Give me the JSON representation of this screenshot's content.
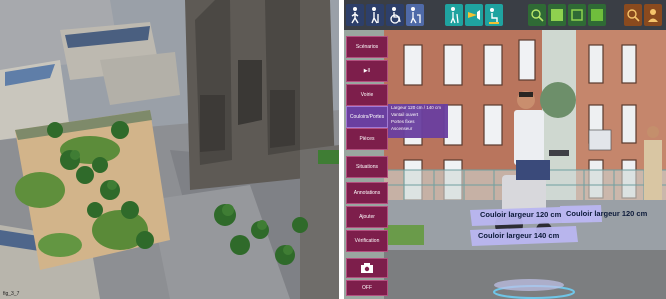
{
  "left_scene": {
    "watermark": "fig_3_7"
  },
  "toolbar": {
    "buttons": [
      {
        "icon": "pedestrian-icon"
      },
      {
        "icon": "elderly-person-icon"
      },
      {
        "icon": "wheelchair-icon"
      },
      {
        "icon": "walker-icon"
      },
      {
        "icon": "cane-person-icon"
      },
      {
        "icon": "camera-view-icon"
      },
      {
        "icon": "person-sitting-icon"
      },
      {
        "icon": "zoom-in-icon"
      },
      {
        "icon": "panel-icon"
      },
      {
        "icon": "square-icon"
      },
      {
        "icon": "screen-icon"
      },
      {
        "icon": "user-icon"
      },
      {
        "icon": "search-icon"
      }
    ]
  },
  "menu": {
    "items": [
      {
        "label": "Scénarios"
      },
      {
        "label": "▶II"
      },
      {
        "label": "Voirie"
      },
      {
        "label": "Couloirs/Portes"
      },
      {
        "label": "Pièces"
      },
      {
        "label": "Situations"
      },
      {
        "label": "Annotations"
      },
      {
        "label": "Ajouter"
      },
      {
        "label": "Vérification"
      }
    ],
    "photo_icon": "camera-icon",
    "off_label": "OFF"
  },
  "submenu": {
    "items": [
      "Largeur 120 cm / 140 cm",
      "Vantail ouvert",
      "Portes fixes",
      "Ascenseur"
    ]
  },
  "labels": {
    "corridor_120": "Couloir largeur 120 cm",
    "corridor_140": "Couloir largeur 140 cm"
  },
  "colors": {
    "menu_bg": "#7d1e4b",
    "menu_active": "#6a3fa0",
    "toolbar_bg": "#3a3e45",
    "label_band": "#b9b6f0"
  }
}
